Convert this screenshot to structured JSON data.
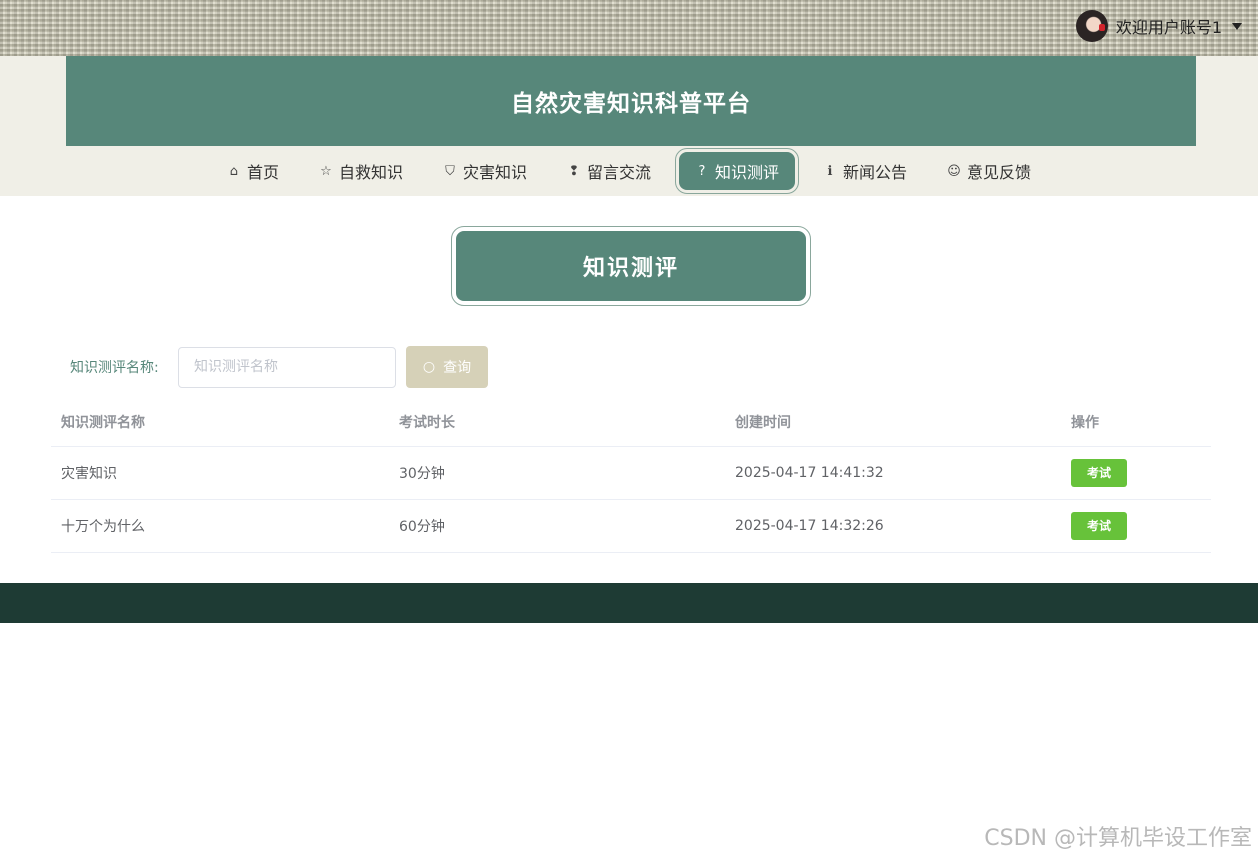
{
  "user": {
    "greeting": "欢迎用户账号1"
  },
  "site": {
    "title": "自然灾害知识科普平台"
  },
  "nav": {
    "items": [
      {
        "label": "首页",
        "icon": "⌂"
      },
      {
        "label": "自救知识",
        "icon": "☆"
      },
      {
        "label": "灾害知识",
        "icon": "⛉"
      },
      {
        "label": "留言交流",
        "icon": "❢"
      },
      {
        "label": "知识测评",
        "icon": "?"
      },
      {
        "label": "新闻公告",
        "icon": "ℹ"
      },
      {
        "label": "意见反馈",
        "icon": "☺"
      }
    ],
    "active_index": 4
  },
  "section": {
    "title": "知识测评"
  },
  "search": {
    "label": "知识测评名称:",
    "placeholder": "知识测评名称",
    "value": "",
    "button_label": "查询"
  },
  "table": {
    "columns": [
      "知识测评名称",
      "考试时长",
      "创建时间",
      "操作"
    ],
    "rows": [
      {
        "name": "灾害知识",
        "duration": "30分钟",
        "created": "2025-04-17 14:41:32",
        "action": "考试"
      },
      {
        "name": "十万个为什么",
        "duration": "60分钟",
        "created": "2025-04-17 14:32:26",
        "action": "考试"
      }
    ]
  },
  "watermark": "CSDN @计算机毕设工作室",
  "colors": {
    "primary": "#57877a",
    "footer": "#1e3b34",
    "search_button": "#d6d1b8",
    "exam_button": "#67c23a"
  }
}
